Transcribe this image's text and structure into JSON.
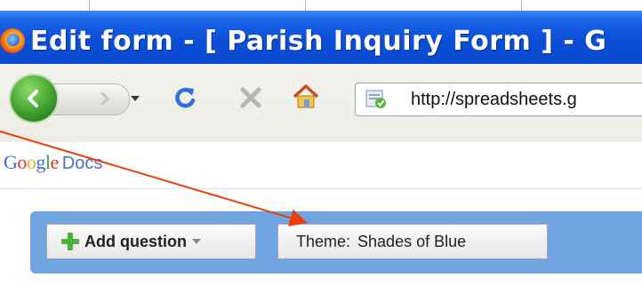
{
  "browser": {
    "window_title": "Edit form - [ Parish Inquiry Form ] - G",
    "url": "http://spreadsheets.g"
  },
  "icons": {
    "browser_logo": "firefox-icon",
    "back": "back-arrow-icon",
    "forward": "forward-arrow-icon",
    "history_dropdown": "chevron-down-icon",
    "reload": "reload-icon",
    "stop": "stop-icon",
    "home": "home-icon",
    "site_identity": "site-identity-icon",
    "add": "plus-icon"
  },
  "app": {
    "logo_google": "Google",
    "logo_docs": "Docs"
  },
  "form_toolbar": {
    "add_question_label": "Add question",
    "theme_label": "Theme:",
    "theme_value": "Shades of Blue"
  },
  "colors": {
    "title_bar": "#0b4fd8",
    "toolbar_blue": "#6fa3e2",
    "annotation_arrow": "#e8400c",
    "add_plus": "#4db13a"
  }
}
